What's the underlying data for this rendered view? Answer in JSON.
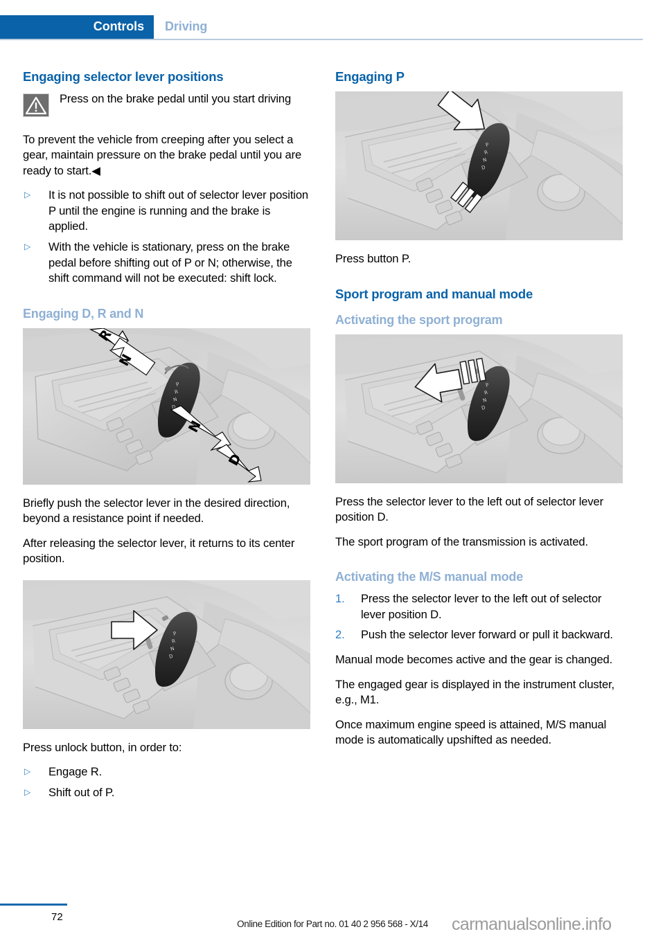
{
  "header": {
    "chapter": "Controls",
    "section": "Driving",
    "chapter_bg": "#0a62a8",
    "section_color": "#8fb0d4"
  },
  "left_column": {
    "heading": "Engaging selector lever positions",
    "warning": {
      "icon": "warning-triangle-icon",
      "text": "Press on the brake pedal until you start driving"
    },
    "warning_body": "To prevent the vehicle from creeping after you select a gear, maintain pressure on the brake pedal until you are ready to start.◀",
    "bullets": [
      "It is not possible to shift out of selector lever position P until the engine is running and the brake is applied.",
      "With the vehicle is stationary, press on the brake pedal before shifting out of P or N; otherwise, the shift command will not be executed: shift lock."
    ],
    "subheading_drn": "Engaging D, R and N",
    "figure_drn": {
      "alt": "gear-selector-console-with-direction-arrows",
      "labels": [
        "R",
        "N",
        "N",
        "D"
      ]
    },
    "paragraphs_after_drn": [
      "Briefly push the selector lever in the desired direction, beyond a resistance point if needed.",
      "After releasing the selector lever, it returns to its center position."
    ],
    "figure_unlock": {
      "alt": "gear-selector-console-unlock-button-arrow"
    },
    "unlock_intro": "Press unlock button, in order to:",
    "unlock_bullets": [
      "Engage R.",
      "Shift out of P."
    ]
  },
  "right_column": {
    "heading_p": "Engaging P",
    "figure_p": {
      "alt": "gear-selector-console-press-p-button-arrow"
    },
    "caption_p": "Press button P.",
    "heading_sport": "Sport program and manual mode",
    "subheading_sport": "Activating the sport program",
    "figure_sport": {
      "alt": "gear-selector-console-push-left-arrow"
    },
    "paragraphs_sport": [
      "Press the selector lever to the left out of selector lever position D.",
      "The sport program of the transmission is activated."
    ],
    "subheading_ms": "Activating the M/S manual mode",
    "steps_ms": [
      {
        "number": "1.",
        "text": "Press the selector lever to the left out of selector lever position D."
      },
      {
        "number": "2.",
        "text": "Push the selector lever forward or pull it backward."
      }
    ],
    "paragraphs_ms": [
      "Manual mode becomes active and the gear is changed.",
      "The engaged gear is displayed in the instrument cluster, e.g., M1.",
      "Once maximum engine speed is attained, M/S manual mode is automatically upshifted as needed."
    ]
  },
  "footer": {
    "page_number": "72",
    "edition_text": "Online Edition for Part no. 01 40 2 956 568 - X/14",
    "watermark": "carmanualsonline.info"
  }
}
